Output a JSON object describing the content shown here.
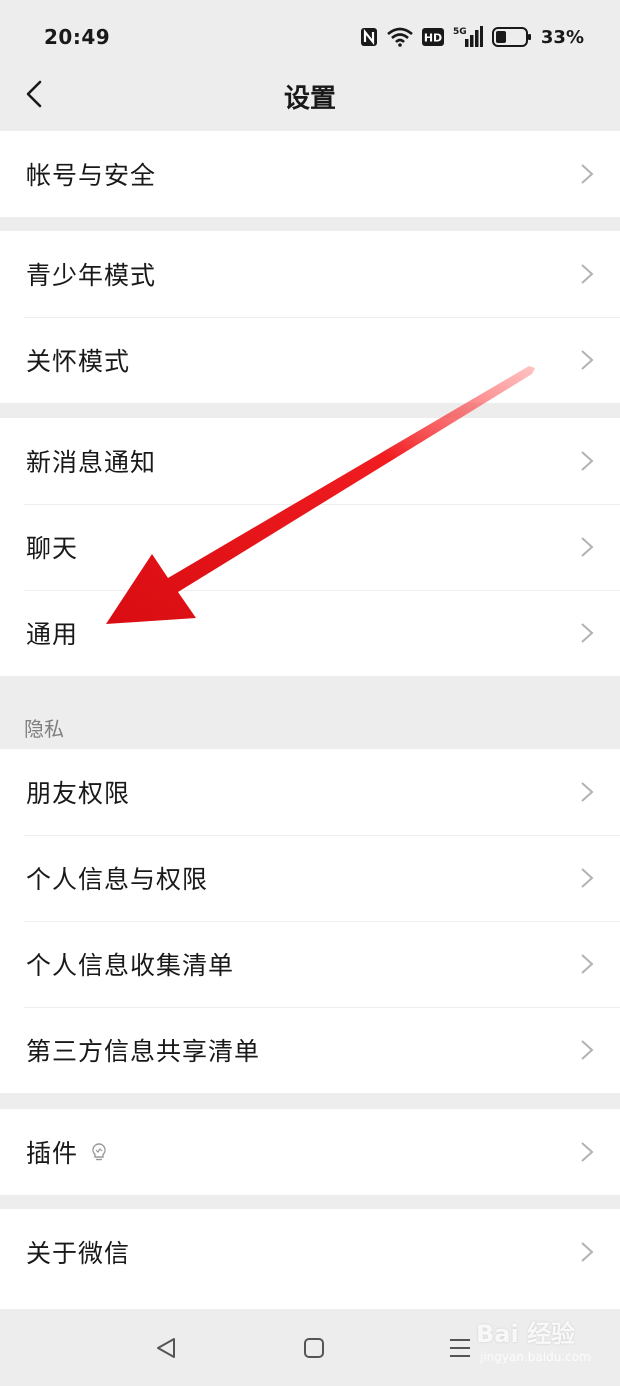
{
  "status_bar": {
    "time": "20:49",
    "network": "5G",
    "battery": "33%",
    "icons": [
      "nfc-icon",
      "wifi-icon",
      "hd-icon",
      "signal-icon",
      "battery-icon"
    ]
  },
  "header": {
    "back_icon": "chevron-left-icon",
    "title": "设置"
  },
  "groups": {
    "account": [
      "帐号与安全"
    ],
    "modes": [
      "青少年模式",
      "关怀模式"
    ],
    "general": [
      "新消息通知",
      "聊天",
      "通用"
    ],
    "privacy_title": "隐私",
    "privacy": [
      "朋友权限",
      "个人信息与权限",
      "个人信息收集清单",
      "第三方信息共享清单"
    ],
    "plugins": [
      "插件"
    ],
    "about": [
      "关于微信"
    ]
  },
  "annotation": {
    "color": "#e8141b",
    "points_to": "通用"
  },
  "watermark": {
    "text": "Bai 经验",
    "sub": "jingyan.baidu.com"
  },
  "nav": {
    "icons": [
      "back-triangle-icon",
      "home-square-icon",
      "menu-lines-icon"
    ]
  }
}
